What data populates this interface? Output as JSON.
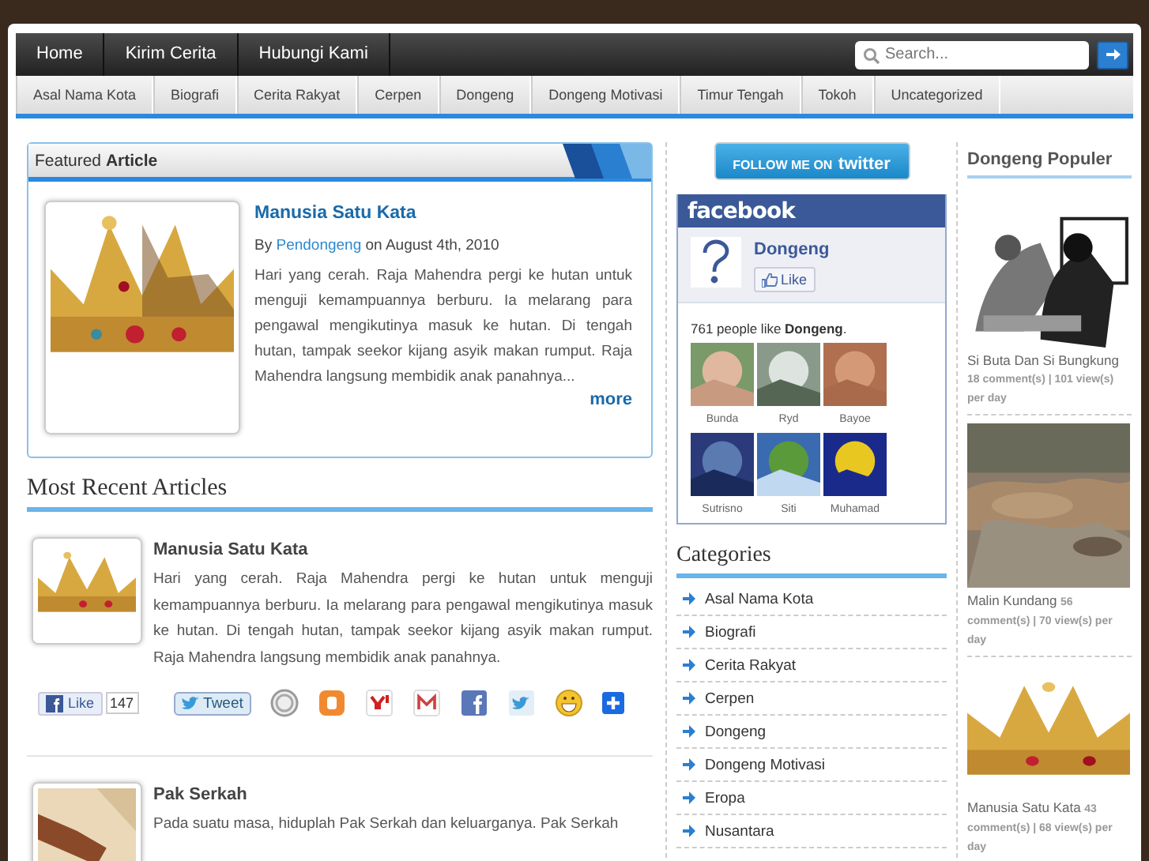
{
  "top_nav": [
    "Home",
    "Kirim Cerita",
    "Hubungi Kami"
  ],
  "search": {
    "placeholder": "Search..."
  },
  "category_bar": [
    "Asal Nama Kota",
    "Biografi",
    "Cerita Rakyat",
    "Cerpen",
    "Dongeng",
    "Dongeng Motivasi",
    "Timur Tengah",
    "Tokoh",
    "Uncategorized"
  ],
  "featured": {
    "heading": "Featured **Article**",
    "title": "Manusia Satu Kata",
    "by": "By",
    "author": "Pendongeng",
    "date": "on August 4th, 2010",
    "excerpt": "Hari yang cerah. Raja Mahendra pergi ke hutan untuk menguji kemampuannya berburu. Ia melarang para pengawal mengikutinya masuk ke hutan. Di tengah hutan, tampak seekor kijang asyik makan rumput. Raja Mahendra langsung membidik anak panahnya...",
    "more": "more"
  },
  "recent": {
    "heading": "Most Recent Articles",
    "posts": [
      {
        "title": "Manusia Satu Kata",
        "excerpt": "Hari yang cerah. Raja Mahendra pergi ke hutan untuk menguji kemampuannya berburu. Ia melarang para pengawal mengikutinya masuk ke hutan. Di tengah hutan, tampak seekor kijang asyik makan rumput. Raja Mahendra langsung membidik anak panahnya.",
        "share": {
          "like": "Like",
          "like_count": "147",
          "tweet": "Tweet"
        }
      },
      {
        "title": "Pak Serkah",
        "excerpt": "Pada suatu masa, hiduplah Pak Serkah dan keluarganya. Pak Serkah"
      }
    ]
  },
  "twitter_button": {
    "prefix": "FOLLOW ME ON",
    "brand": "twitter"
  },
  "facebook_box": {
    "logo": "facebook",
    "page": "Dongeng",
    "like": "Like",
    "likes_text": "761 people like **Dongeng**.",
    "fans": [
      "Bunda",
      "Ryd",
      "Bayoe",
      "Sutrisno",
      "Siti",
      "Muhamad"
    ]
  },
  "categories": {
    "heading": "Categories",
    "items": [
      "Asal Nama Kota",
      "Biografi",
      "Cerita Rakyat",
      "Cerpen",
      "Dongeng",
      "Dongeng Motivasi",
      "Eropa",
      "Nusantara"
    ]
  },
  "popular": {
    "heading": "Dongeng Populer",
    "items": [
      {
        "title": "Si Buta Dan Si Bungkung",
        "stats": "18 comment(s) | 101 view(s) per day"
      },
      {
        "title": "Malin Kundang",
        "stats": "56 comment(s) | 70 view(s) per day"
      },
      {
        "title": "Manusia Satu Kata",
        "stats": "43 comment(s) | 68 view(s) per day"
      }
    ]
  }
}
